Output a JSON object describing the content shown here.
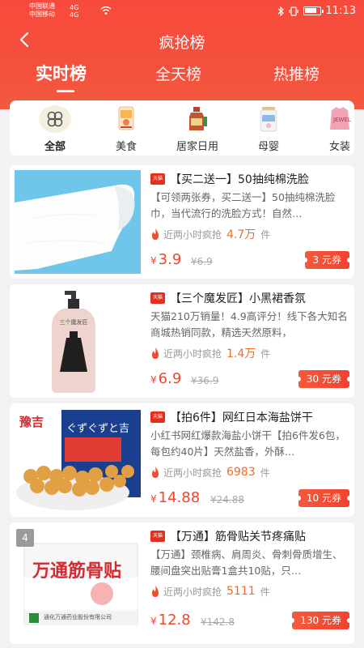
{
  "status_bar": {
    "carrier1": "中国联通",
    "carrier2": "中国移动",
    "net1": "4G",
    "net2": "4G",
    "time": "11:13",
    "battery_level": 0.8
  },
  "nav": {
    "title": "疯抢榜"
  },
  "tabs": [
    {
      "label": "实时榜",
      "active": true
    },
    {
      "label": "全天榜",
      "active": false
    },
    {
      "label": "热推榜",
      "active": false
    }
  ],
  "categories": [
    {
      "label": "全部",
      "icon": "clover-icon",
      "active": true
    },
    {
      "label": "美食",
      "icon": "food-icon"
    },
    {
      "label": "居家日用",
      "icon": "household-icon"
    },
    {
      "label": "母婴",
      "icon": "baby-formula-icon"
    },
    {
      "label": "女装",
      "icon": "women-clothing-icon"
    }
  ],
  "products": [
    {
      "tag": "天猫",
      "title": "【买二送一】50抽纯棉洗脸",
      "desc": "【可领两张券，买二送一】50抽纯棉洗脸巾，当代流行的洗脸方式！自然…",
      "hot_prefix": "近两小时疯抢",
      "hot_count": "4.7万",
      "hot_unit": "件",
      "price_symbol": "¥",
      "price": "3.9",
      "original_price": "¥6.9",
      "coupon": "3 元券",
      "image": "cotton-towel-image"
    },
    {
      "tag": "天猫",
      "title": "【三个魔发匠】小黑裙香氛",
      "desc": "天猫210万销量！4.9高评分！线下各大知名商城热销同款，精选天然原料，",
      "hot_prefix": "近两小时疯抢",
      "hot_count": "1.4万",
      "hot_unit": "件",
      "price_symbol": "¥",
      "price": "6.9",
      "original_price": "¥36.9",
      "coupon": "30 元券",
      "image": "shampoo-bottle-image",
      "bottle_label": "三个魔发匠"
    },
    {
      "tag": "天猫",
      "title": "【拍6件】网红日本海盐饼干",
      "desc": "小红书网红爆款海盐小饼干【拍6件发6包，每包约40片】天然盐香，外酥…",
      "hot_prefix": "近两小时疯抢",
      "hot_count": "6983",
      "hot_unit": "件",
      "price_symbol": "¥",
      "price": "14.88",
      "original_price": "¥24.88",
      "coupon": "10 元券",
      "image": "biscuit-image",
      "brand_text": "豫吉",
      "pack_text": "ぐずぐずと吉"
    },
    {
      "rank": "4",
      "tag": "天猫",
      "title": "【万通】筋骨贴关节疼痛贴",
      "desc": "【万通】颈椎病、肩周炎、骨刺骨质增生、腰间盘突出贴膏1盒共10贴，只…",
      "hot_prefix": "近两小时疯抢",
      "hot_count": "5111",
      "hot_unit": "件",
      "price_symbol": "¥",
      "price": "12.8",
      "original_price": "¥142.8",
      "coupon": "130 元券",
      "image": "plaster-box-image",
      "box_title": "万通筋骨贴",
      "box_maker": "通化万通药业股份有限公司"
    }
  ]
}
